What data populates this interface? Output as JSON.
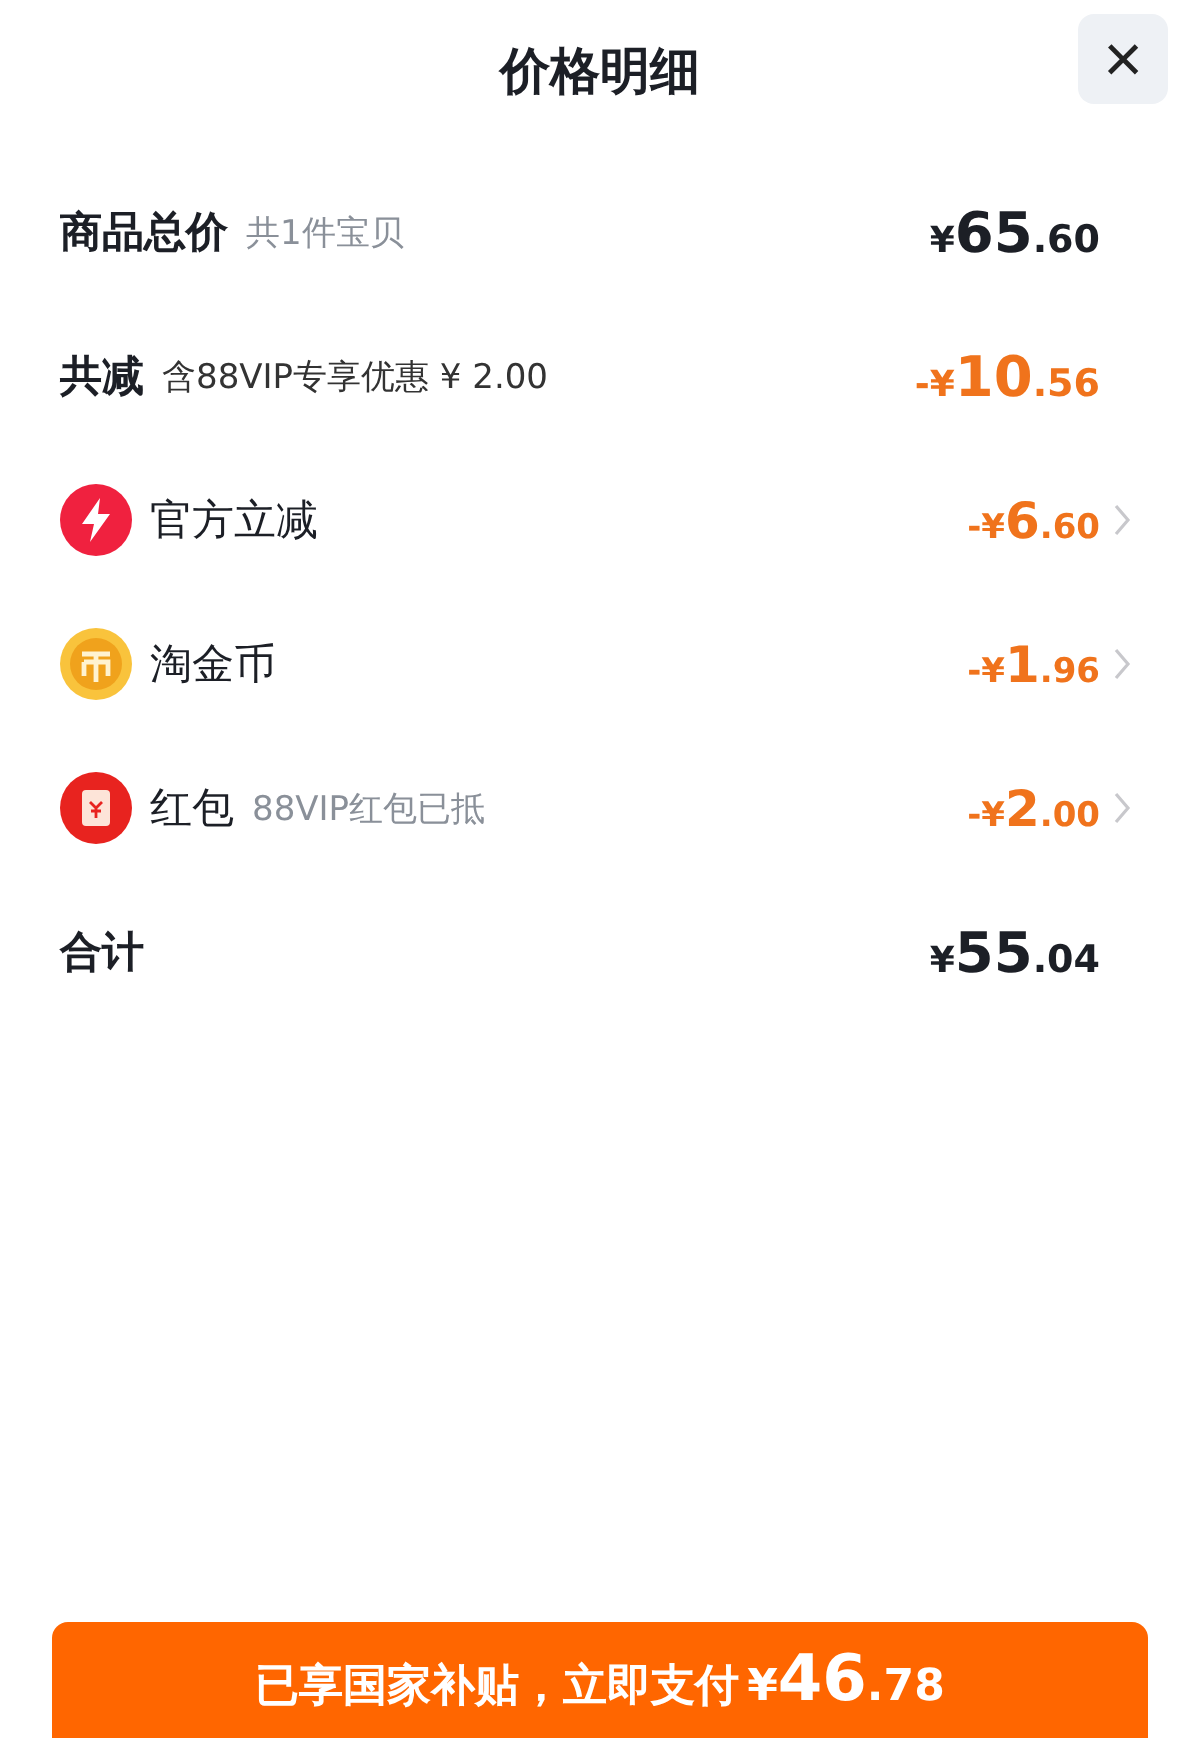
{
  "header": {
    "title": "价格明细",
    "close": "×"
  },
  "rows": [
    {
      "kind": "summary",
      "label": "商品总价",
      "note": "共1件宝贝",
      "prefix": "¥",
      "whole": "65",
      "fraction": ".60",
      "discount": false
    },
    {
      "kind": "summary",
      "label": "共减",
      "note": "含88VIP专享优惠 ¥ 2.00",
      "prefix": "-¥",
      "whole": "10",
      "fraction": ".56",
      "discount": true
    },
    {
      "kind": "bolt",
      "label": "官方立减",
      "prefix": "-¥",
      "whole": "6",
      "fraction": ".60",
      "discount": true
    },
    {
      "kind": "coin",
      "label": "淘金币",
      "prefix": "-¥",
      "whole": "1",
      "fraction": ".96",
      "discount": true
    },
    {
      "kind": "packet",
      "label": "红包",
      "note": "88VIP红包已抵",
      "prefix": "-¥",
      "whole": "2",
      "fraction": ".00",
      "discount": true
    },
    {
      "kind": "total",
      "label": "合计",
      "prefix": "¥",
      "whole": "55",
      "fraction": ".04",
      "discount": false
    }
  ],
  "pay_button": {
    "label": "已享国家补贴，立即支付",
    "prefix": "¥",
    "whole": "46",
    "fraction": ".78"
  }
}
